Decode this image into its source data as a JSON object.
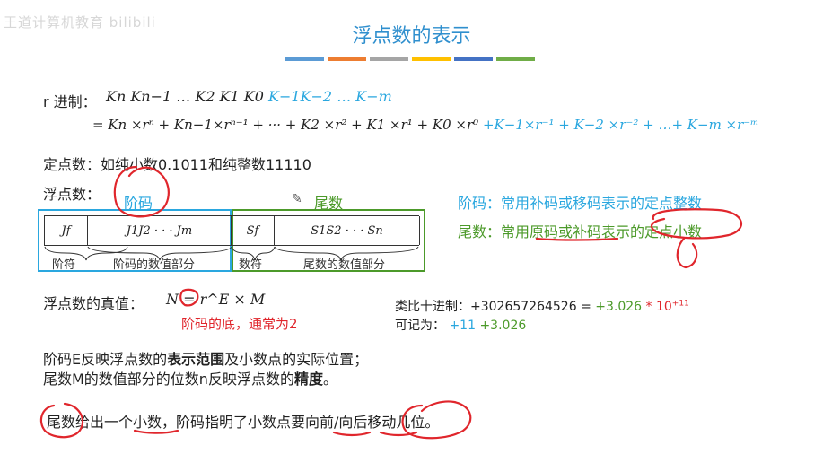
{
  "watermark": "王道计算机教育 bilibili",
  "title": "浮点数的表示",
  "accent_bar_colors": [
    "#5b9bd5",
    "#ed7d31",
    "#a5a5a5",
    "#ffc000",
    "#4472c4",
    "#70ad47"
  ],
  "radix": {
    "label": "r 进制：",
    "line1_black": "Kn Kn−1 … K2 K1 K0",
    "line1_cyan": "K−1K−2 … K−m",
    "line2_black": "= Kn ×rⁿ + Kn−1×rⁿ⁻¹ + ··· + K2 ×r² + K1 ×r¹ + K0 ×r⁰",
    "line2_cyan": "+K−1×r⁻¹ + K−2 ×r⁻² + …+ K−m ×r⁻ᵐ"
  },
  "fixed_point": "定点数：如纯小数0.1011和纯整数11110",
  "floating": {
    "label": "浮点数：",
    "exp_label": "阶码",
    "mantissa_label": "尾数",
    "cells": [
      "Jf",
      "J1J2 · · · Jm",
      "Sf",
      "S1S2 · · · Sn"
    ],
    "captions": [
      "阶符",
      "阶码的数值部分",
      "数符",
      "尾数的数值部分"
    ],
    "note_exp": "阶码：常用补码或移码表示的定点整数",
    "note_mantissa": "尾数：常用原码或补码表示的定点小数"
  },
  "true_value": {
    "label": "浮点数的真值：",
    "formula": "N = r^E × M",
    "note": "阶码的底，通常为2"
  },
  "analogy": {
    "line1_black": "类比十进制：+302657264526 =",
    "line1_green": "+3.026",
    "line1_red": "* 10",
    "line1_exp": "+11",
    "line2_black": "可记为：",
    "line2_cyan": "+11",
    "line2_green": "+3.026"
  },
  "summary": {
    "line1_a": "阶码E反映浮点数的",
    "line1_b": "表示范围",
    "line1_c": "及小数点的实际位置；",
    "line2_a": "尾数M的数值部分的位数n反映浮点数的",
    "line2_b": "精度",
    "line2_c": "。",
    "line3": "尾数给出一个小数，阶码指明了小数点要向前/向后移动几位。"
  }
}
